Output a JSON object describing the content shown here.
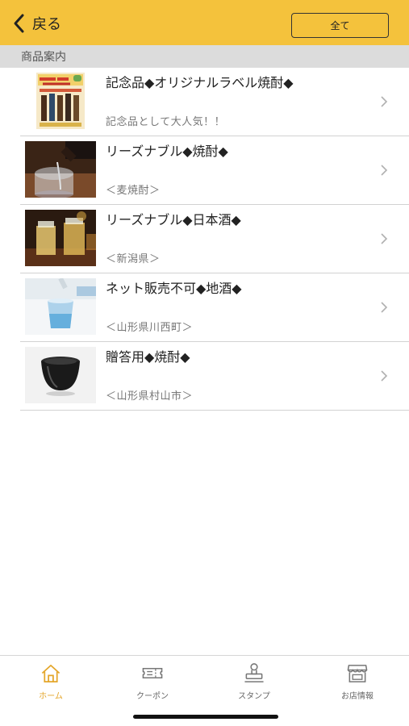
{
  "header": {
    "back_label": "戻る",
    "all_button": "全て"
  },
  "section": {
    "title": "商品案内"
  },
  "products": [
    {
      "title": "記念品◆オリジナルラベル焼酎◆",
      "subtitle": "記念品として大人気！！",
      "image": "original-label-poster"
    },
    {
      "title": "リーズナブル◆焼酎◆",
      "subtitle": "＜麦焼酎＞",
      "image": "pouring-glass-photo"
    },
    {
      "title": "リーズナブル◆日本酒◆",
      "subtitle": "＜新潟県＞",
      "image": "toasting-glasses-photo"
    },
    {
      "title": "ネット販売不可◆地酒◆",
      "subtitle": "＜山形県川西町＞",
      "image": "blue-glass-photo"
    },
    {
      "title": "贈答用◆焼酎◆",
      "subtitle": "＜山形県村山市＞",
      "image": "black-cup-photo"
    }
  ],
  "tabbar": {
    "tabs": [
      {
        "label": "ホーム",
        "icon": "home-icon",
        "active": true
      },
      {
        "label": "クーポン",
        "icon": "coupon-icon",
        "active": false
      },
      {
        "label": "スタンプ",
        "icon": "stamp-icon",
        "active": false
      },
      {
        "label": "お店情報",
        "icon": "shop-icon",
        "active": false
      }
    ]
  },
  "colors": {
    "header_bg": "#f4c23c",
    "section_bg": "#dcdcdc",
    "active_tab": "#e4a62a"
  }
}
